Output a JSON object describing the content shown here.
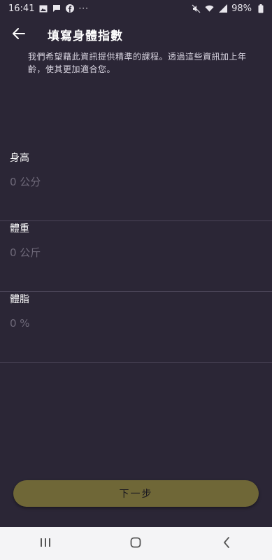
{
  "status_bar": {
    "time": "16:41",
    "more": "···",
    "battery": "98%",
    "left_icons": [
      "gallery-icon",
      "message-icon",
      "facebook-icon"
    ],
    "right_icons": [
      "mute-icon",
      "wifi-icon",
      "signal-icon",
      "battery-icon"
    ]
  },
  "header": {
    "back_icon": "arrow-left-icon",
    "title": "填寫身體指數"
  },
  "description": "我們希望藉此資訊提供精準的課程。透過這些資訊加上年齡，使其更加適合您。",
  "fields": [
    {
      "label": "身高",
      "placeholder": "0 公分",
      "value": ""
    },
    {
      "label": "體重",
      "placeholder": "0 公斤",
      "value": ""
    },
    {
      "label": "體脂",
      "placeholder": "0 %",
      "value": ""
    }
  ],
  "next_button": {
    "label": "下一步",
    "color": "#6f6737"
  },
  "nav_bar": {
    "items": [
      "recent-apps-icon",
      "home-icon",
      "back-icon"
    ]
  },
  "colors": {
    "background": "#2b2636",
    "divider": "#4a4457",
    "accent": "#6f6737"
  }
}
